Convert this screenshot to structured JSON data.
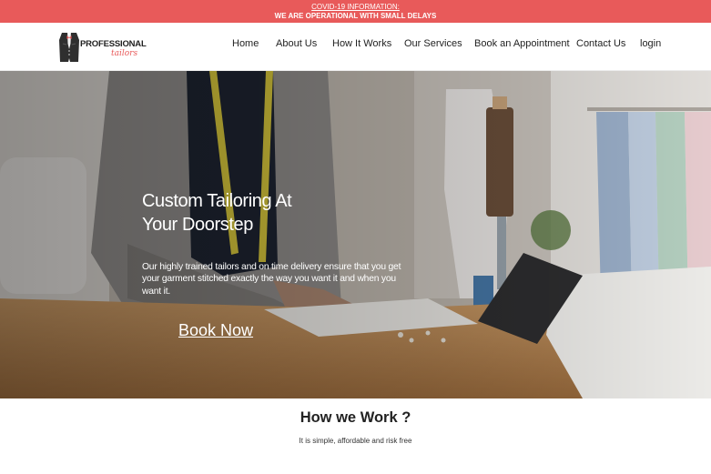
{
  "banner": {
    "link_text": "COVID-19 INFORMATION:",
    "message": "WE ARE OPERATIONAL WITH SMALL DELAYS",
    "color": "#e85a5a"
  },
  "brand": {
    "name_line1": "PROFESSIONAL",
    "name_line2": "tailors",
    "accent_color": "#e85a5a"
  },
  "nav": {
    "home": "Home",
    "about": "About Us",
    "how_it_works": "How It Works",
    "services": "Our Services",
    "book": "Book an Appointment",
    "contact": "Contact Us",
    "login": "login"
  },
  "hero": {
    "title_line1": "Custom Tailoring At",
    "title_line2": "Your Doorstep",
    "description": "Our highly trained tailors and on time delivery ensure that you get your garment stitched exactly the way you want it and when you want it.",
    "cta": "Book Now"
  },
  "how_section": {
    "title": "How we Work ?",
    "subtitle": "It is simple, affordable and risk free"
  }
}
